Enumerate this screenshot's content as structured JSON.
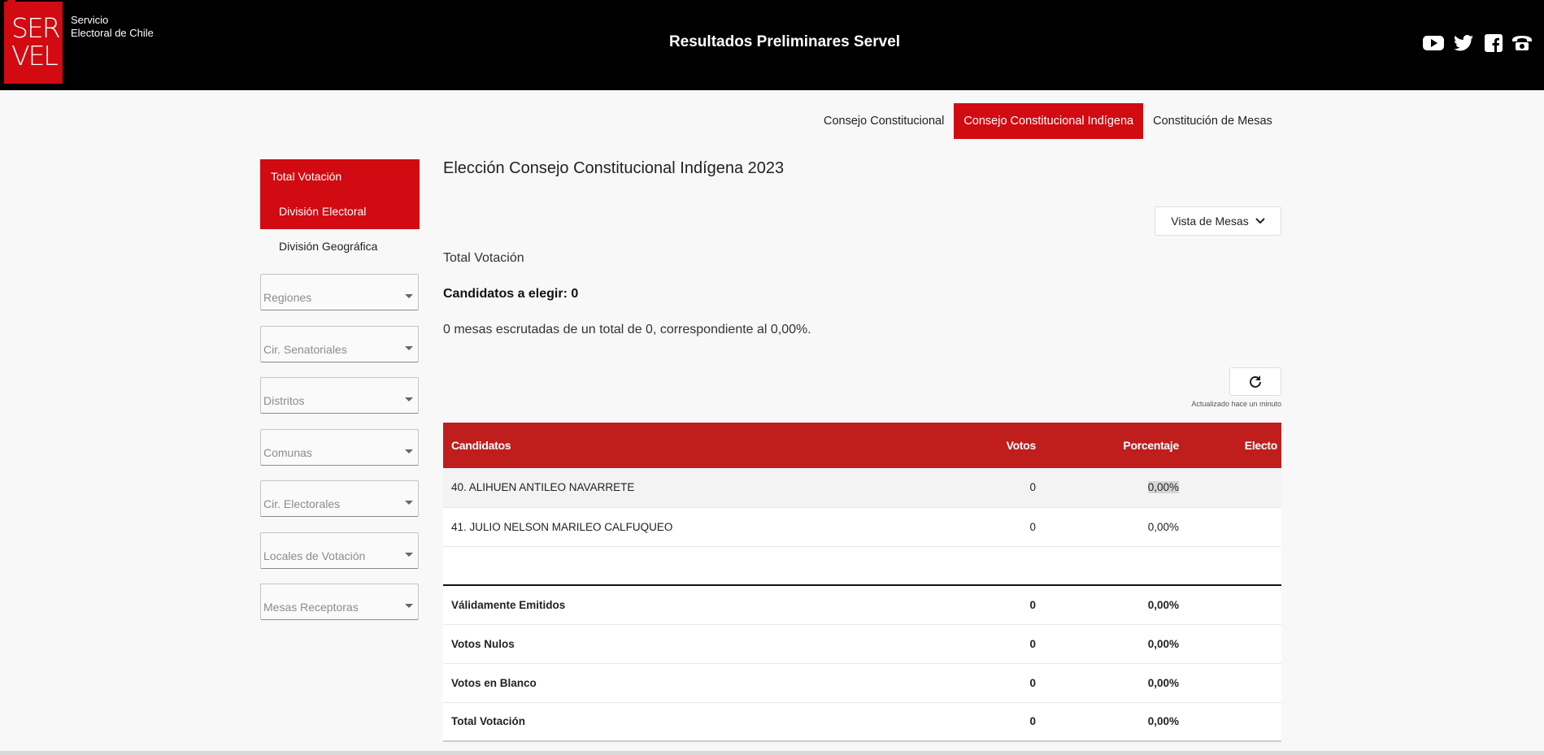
{
  "header": {
    "logo_line1": "SER",
    "logo_line2": "VEL",
    "org_line1": "Servicio",
    "org_line2": "Electoral de Chile",
    "title": "Resultados Preliminares Servel",
    "social_icons": [
      "youtube-icon",
      "twitter-icon",
      "facebook-icon",
      "phone-icon"
    ]
  },
  "tabs": [
    {
      "label": "Consejo Constitucional",
      "active": false
    },
    {
      "label": "Consejo Constitucional Indígena",
      "active": true
    },
    {
      "label": "Constitución de Mesas",
      "active": false
    }
  ],
  "sidebar": {
    "main": "Total Votación",
    "items": [
      {
        "label": "División Electoral",
        "active": true
      },
      {
        "label": "División Geográfica",
        "active": false
      }
    ],
    "filters": [
      "Regiones",
      "Cir. Senatoriales",
      "Distritos",
      "Comunas",
      "Cir. Electorales",
      "Locales de Votación",
      "Mesas Receptoras"
    ]
  },
  "main": {
    "title": "Elección Consejo Constitucional Indígena 2023",
    "view_button": "Vista de Mesas",
    "section_label": "Total Votación",
    "candidates_to_elect": "Candidatos a elegir: 0",
    "mesas_text": "0 mesas escrutadas de un total de 0, correspondiente al 0,00%.",
    "updated": "Actualizado hace un minuto"
  },
  "table": {
    "headers": {
      "candidatos": "Candidatos",
      "votos": "Votos",
      "porcentaje": "Porcentaje",
      "electo": "Electo"
    },
    "rows": [
      {
        "name": "40. ALIHUEN ANTILEO NAVARRETE",
        "votos": "0",
        "pct": "0,00%",
        "electo": ""
      },
      {
        "name": "41. JULIO NELSON MARILEO CALFUQUEO",
        "votos": "0",
        "pct": "0,00%",
        "electo": ""
      }
    ],
    "summary": [
      {
        "name": "Válidamente Emitidos",
        "votos": "0",
        "pct": "0,00%"
      },
      {
        "name": "Votos Nulos",
        "votos": "0",
        "pct": "0,00%"
      },
      {
        "name": "Votos en Blanco",
        "votos": "0",
        "pct": "0,00%"
      },
      {
        "name": "Total Votación",
        "votos": "0",
        "pct": "0,00%"
      }
    ]
  },
  "colors": {
    "brand_red": "#d20a11",
    "table_header": "#c01d1d",
    "topbar": "#000000"
  }
}
